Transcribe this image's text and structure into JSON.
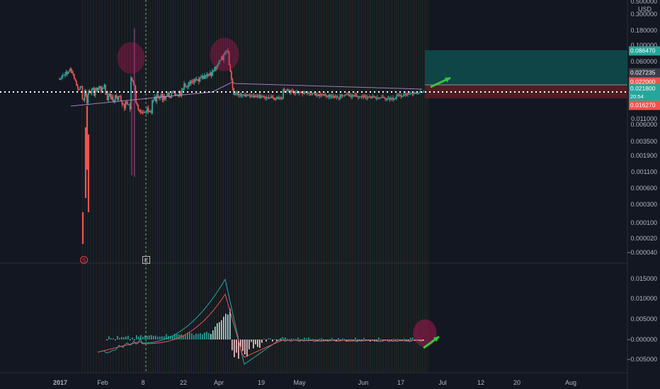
{
  "currency": "USD",
  "colors": {
    "background": "#131722",
    "up": "#26a69a",
    "down": "#ef5350",
    "macd": "#2ba6a0",
    "signal": "#ef5350",
    "arrow": "#3ec23e",
    "target_zone": "#0f4e4e",
    "stop_zone": "#5b1e25",
    "vertical_line_green": "#2a4b2a",
    "vertical_line_orange": "#5a3a1a",
    "highlight_circle": "#c2185b"
  },
  "price_axis": {
    "ticks": [
      "0.500000",
      "0.300000",
      "0.180000",
      "0.100000",
      "0.060000",
      "0.038000",
      "0.022000",
      "0.013000",
      "0.011000",
      "0.006000",
      "0.003500",
      "0.001900",
      "0.001100",
      "0.000600",
      "0.000300",
      "0.000100",
      "0.000020",
      "−0.000040"
    ]
  },
  "price_tags": [
    {
      "value": "0.086470",
      "color": "#26a69a"
    },
    {
      "value": "0.027235",
      "color": "#3a3e4a"
    },
    {
      "value": "0.022000",
      "color": "#ef5350"
    },
    {
      "value": "0.021800",
      "color": "#26a69a",
      "sub": "20:54"
    },
    {
      "value": "0.016270",
      "color": "#ef5350"
    }
  ],
  "macd_axis": {
    "ticks": [
      "0.015000",
      "0.010000",
      "0.005000",
      "−0.000000",
      "−0.005000"
    ]
  },
  "time_axis": {
    "ticks": [
      "2017",
      "Feb",
      "8",
      "22",
      "Apr",
      "19",
      "May",
      "Jun",
      "17",
      "Jul",
      "12",
      "20",
      "Aug"
    ]
  },
  "markers": {
    "start": "S",
    "end": "E"
  }
}
